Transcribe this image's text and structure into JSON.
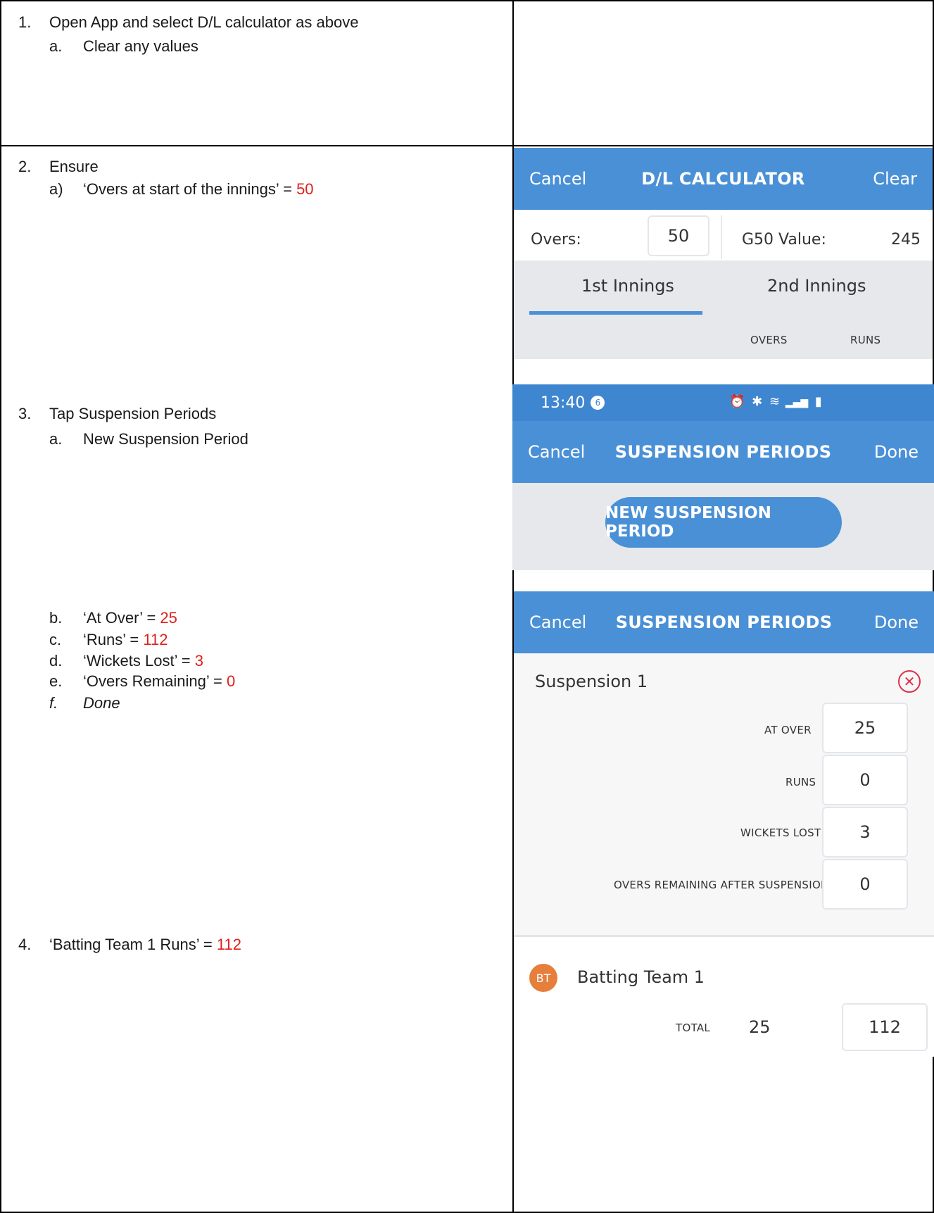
{
  "steps": {
    "s1": "1.",
    "s1_text": "Open App and select D/L calculator as above",
    "s1a": "a.",
    "s1a_text": "Clear any values",
    "s2": "2.",
    "s2_text": "Ensure",
    "s2a": "a)",
    "s2a_text": "‘Overs at start of the innings’ = ",
    "s2a_val": "50",
    "s3": "3.",
    "s3_text": "Tap Suspension Periods",
    "s3a": "a.",
    "s3a_text": "New Suspension Period",
    "s3b": "b.",
    "s3b_text": "‘At Over’ = ",
    "s3b_val": "25",
    "s3c": "c.",
    "s3c_text": "‘Runs’ = ",
    "s3c_val": "112",
    "s3d": "d.",
    "s3d_text": "‘Wickets Lost’ = ",
    "s3d_val": "3",
    "s3e": "e.",
    "s3e_text": "‘Overs Remaining’ = ",
    "s3e_val": "0",
    "s3f": "f.",
    "s3f_text": "Done",
    "s4": "4.",
    "s4_text": "‘Batting Team 1 Runs’ = ",
    "s4_val": "112"
  },
  "calc": {
    "cancel": "Cancel",
    "title": "D/L CALCULATOR",
    "clear": "Clear",
    "overs_label": "Overs:",
    "overs_value": "50",
    "g50_label": "G50 Value:",
    "g50_value": "245",
    "tab1": "1st Innings",
    "tab2": "2nd Innings",
    "col_overs": "OVERS",
    "col_runs": "RUNS"
  },
  "susp_list": {
    "time": "13:40",
    "notif_count": "6",
    "cancel": "Cancel",
    "title": "SUSPENSION PERIODS",
    "done": "Done",
    "new_button": "NEW SUSPENSION PERIOD"
  },
  "susp_detail": {
    "cancel": "Cancel",
    "title": "SUSPENSION PERIODS",
    "done": "Done",
    "name": "Suspension 1",
    "at_over_label": "AT OVER",
    "at_over_value": "25",
    "runs_label": "RUNS",
    "runs_value": "0",
    "wickets_label": "WICKETS LOST",
    "wickets_value": "3",
    "overs_rem_label": "OVERS REMAINING AFTER SUSPENSION",
    "overs_rem_value": "0"
  },
  "batting": {
    "avatar": "BT",
    "team": "Batting Team 1",
    "total_label": "TOTAL",
    "overs": "25",
    "runs": "112"
  },
  "colors": {
    "accent": "#4a90d6",
    "highlight_red": "#e0201c",
    "remove_icon": "#e0304a",
    "avatar": "#e67e3c"
  }
}
